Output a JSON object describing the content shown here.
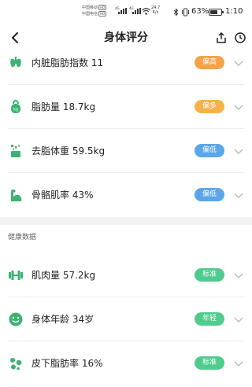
{
  "status_bar": {
    "carrier_1": "中国移动",
    "carrier_2": "中国电信",
    "carrier_badge": "HD",
    "signal_label_1": "4G",
    "signal_label_2": "4G",
    "net_speed_value": "24.7",
    "net_speed_unit": "K/s",
    "battery_percent": "63%",
    "battery_level": 0.63,
    "time": "1:10"
  },
  "header": {
    "title": "身体评分"
  },
  "metrics_top": [
    {
      "label": "内脏脂肪指数 11",
      "badge": "偏高",
      "badge_color": "#F5A24B",
      "icon": "visceral-fat-icon"
    },
    {
      "label": "脂肪量 18.7kg",
      "badge": "偏多",
      "badge_color": "#F5B24B",
      "icon": "kettlebell-icon"
    },
    {
      "label": "去脂体重 59.5kg",
      "badge": "偏低",
      "badge_color": "#5AA6EB",
      "icon": "lean-mass-icon"
    },
    {
      "label": "骨骼肌率 43%",
      "badge": "偏低",
      "badge_color": "#5AA6EB",
      "icon": "muscle-arm-icon"
    }
  ],
  "section": {
    "title": "健康数据"
  },
  "metrics_bottom": [
    {
      "label": "肌肉量 57.2kg",
      "badge": "标准",
      "badge_color": "#4FCB8E",
      "icon": "dumbbell-icon"
    },
    {
      "label": "身体年龄 34岁",
      "badge": "年轻",
      "badge_color": "#4FCB8E",
      "icon": "smiley-icon"
    },
    {
      "label": "皮下脂肪率 16%",
      "badge": "标准",
      "badge_color": "#4FCB8E",
      "icon": "subcutaneous-fat-icon"
    }
  ],
  "colors": {
    "icon_green": "#3CB371",
    "chevron": "#BBBBBB"
  }
}
